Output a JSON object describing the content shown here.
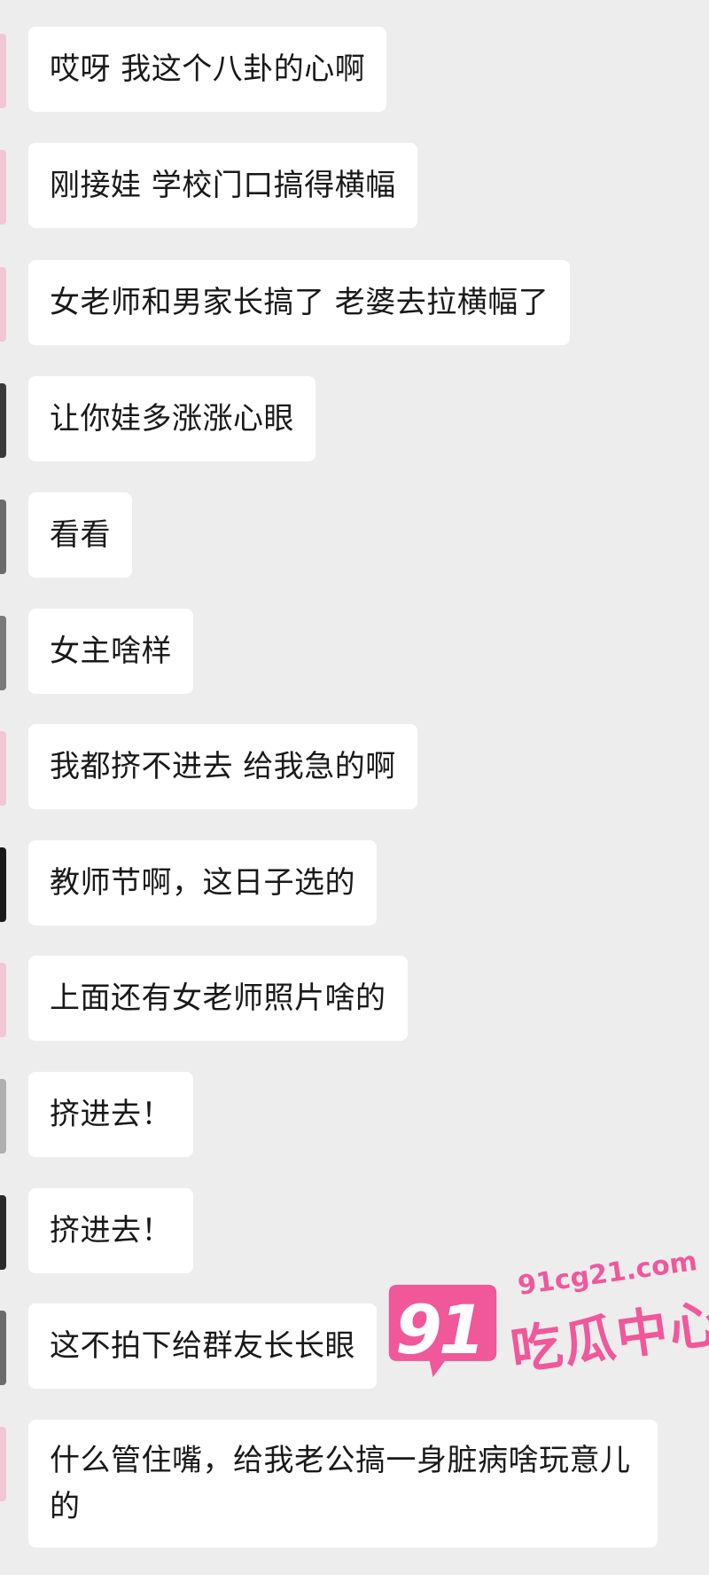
{
  "messages": [
    {
      "text": "哎呀 我这个八卦的心啊",
      "avatar_color": "#f2c7d4"
    },
    {
      "text": "刚接娃 学校门口搞得横幅",
      "avatar_color": "#f2c7d4"
    },
    {
      "text": "女老师和男家长搞了 老婆去拉横幅了",
      "avatar_color": "#f2c7d4"
    },
    {
      "text": "让你娃多涨涨心眼",
      "avatar_color": "#3a3a3a"
    },
    {
      "text": "看看",
      "avatar_color": "#6b6b6b"
    },
    {
      "text": "女主啥样",
      "avatar_color": "#7a7a7a"
    },
    {
      "text": "我都挤不进去 给我急的啊",
      "avatar_color": "#f2c7d4"
    },
    {
      "text": "教师节啊，这日子选的",
      "avatar_color": "#1a1a1a"
    },
    {
      "text": "上面还有女老师照片啥的",
      "avatar_color": "#f2c7d4"
    },
    {
      "text": "挤进去！",
      "avatar_color": "#b0b0b0"
    },
    {
      "text": "挤进去！",
      "avatar_color": "#2a2a2a"
    },
    {
      "text": "这不拍下给群友长长眼",
      "avatar_color": "#6b6b6b"
    },
    {
      "text": "什么管住嘴，给我老公搞一身脏病啥玩意儿的",
      "avatar_color": "#f2c7d4"
    }
  ],
  "watermark": {
    "number": "91",
    "domain": "91cg21.com",
    "name": "吃瓜中心",
    "color": "#f0589a"
  }
}
